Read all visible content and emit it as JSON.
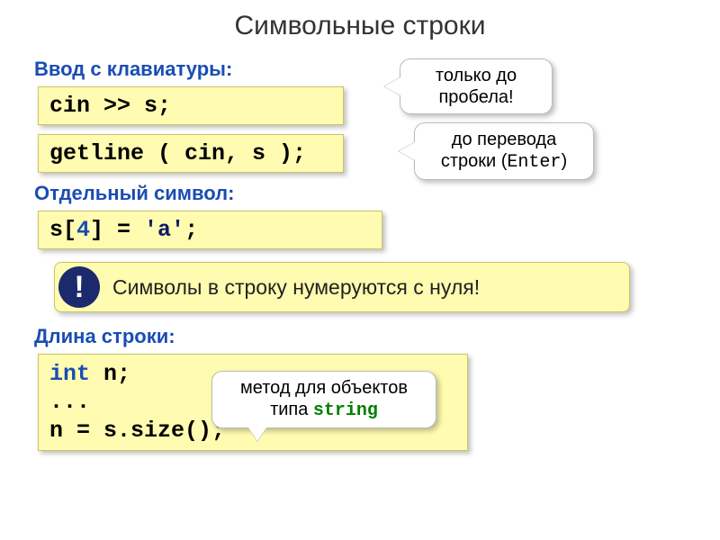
{
  "title": "Символьные строки",
  "sections": {
    "input": "Ввод с клавиатуры:",
    "single": "Отдельный символ:",
    "length": "Длина строки:"
  },
  "code": {
    "cin": "cin >> s;",
    "getline": "getline ( cin, s );",
    "index_pre": "s[",
    "index_num": "4",
    "index_mid": "] = ",
    "index_char": "'a'",
    "index_post": ";",
    "len_kw": "int",
    "len_l1": " n;",
    "len_l2": "...",
    "len_l3": "n = s.size();"
  },
  "callouts": {
    "space": "только до\nпробела!",
    "enter_pre": "до перевода\nстроки (",
    "enter_mono": "Enter",
    "enter_post": ")",
    "method_pre": "метод для объектов\nтипа ",
    "method_mono": "string"
  },
  "note": {
    "badge": "!",
    "text": "Символы в строку нумеруются с нуля!"
  }
}
